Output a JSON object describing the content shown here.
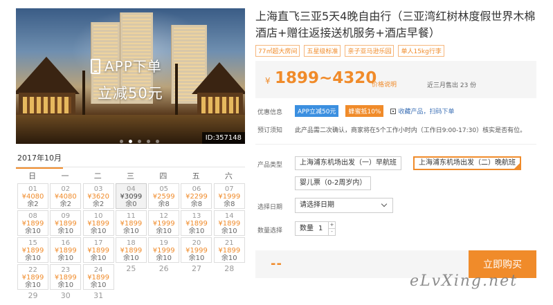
{
  "hero": {
    "banner_line1": "APP下单",
    "banner_line2": "立减50元",
    "product_id": "ID:357148",
    "slide_count": 5,
    "active_slide": 1
  },
  "calendar": {
    "month": "2017年10月",
    "weekdays": [
      "日",
      "一",
      "二",
      "三",
      "四",
      "五",
      "六"
    ],
    "days": [
      {
        "day": "01",
        "price": "¥4080",
        "stock": "余2"
      },
      {
        "day": "02",
        "price": "¥4080",
        "stock": "余2"
      },
      {
        "day": "03",
        "price": "¥3620",
        "stock": "余2"
      },
      {
        "day": "04",
        "price": "¥3099",
        "stock": "余0",
        "selected": true
      },
      {
        "day": "05",
        "price": "¥2599",
        "stock": "余8"
      },
      {
        "day": "06",
        "price": "¥2299",
        "stock": "余8"
      },
      {
        "day": "07",
        "price": "¥1999",
        "stock": "余8"
      },
      {
        "day": "08",
        "price": "¥1899",
        "stock": "余10"
      },
      {
        "day": "09",
        "price": "¥1899",
        "stock": "余10"
      },
      {
        "day": "10",
        "price": "¥1899",
        "stock": "余10"
      },
      {
        "day": "11",
        "price": "¥1899",
        "stock": "余10"
      },
      {
        "day": "12",
        "price": "¥1999",
        "stock": "余10"
      },
      {
        "day": "13",
        "price": "¥1899",
        "stock": "余10"
      },
      {
        "day": "14",
        "price": "¥1899",
        "stock": "余10"
      },
      {
        "day": "15",
        "price": "¥1899",
        "stock": "余10"
      },
      {
        "day": "16",
        "price": "¥1899",
        "stock": "余10"
      },
      {
        "day": "17",
        "price": "¥1899",
        "stock": "余10"
      },
      {
        "day": "18",
        "price": "¥1899",
        "stock": "余10"
      },
      {
        "day": "19",
        "price": "¥1999",
        "stock": "余10"
      },
      {
        "day": "20",
        "price": "¥1999",
        "stock": "余10"
      },
      {
        "day": "21",
        "price": "¥1899",
        "stock": "余10"
      },
      {
        "day": "22",
        "price": "¥1899",
        "stock": "余10"
      },
      {
        "day": "23",
        "price": "¥1899",
        "stock": "余10"
      },
      {
        "day": "24",
        "price": "¥1899",
        "stock": "余10"
      },
      {
        "day": "25"
      },
      {
        "day": "26"
      },
      {
        "day": "27"
      },
      {
        "day": "28"
      },
      {
        "day": "29"
      },
      {
        "day": "30"
      },
      {
        "day": "31"
      }
    ]
  },
  "product": {
    "title": "上海直飞三亚5天4晚自由行（三亚湾红树林度假世界木棉酒店+赠往返接送机服务+酒店早餐）",
    "tags": [
      "77㎡超大房间",
      "五星级标准",
      "亲子亚马逊乐园",
      "单人15kg行李"
    ],
    "price_currency": "¥",
    "price_range": "1899~4320",
    "price_note": "价格说明",
    "sold_text": "近三月售出 23 份"
  },
  "promo": {
    "label": "优惠信息",
    "badge_app": "APP立减50元",
    "badge_bee": "蜂蜜抵10%",
    "qr_text": "收藏产品，扫码下单"
  },
  "notice": {
    "label": "预订须知",
    "text": "此产品需二次确认，商家将在5个工作小时内（工作日9:00-17:30）核实是否有位。"
  },
  "product_type": {
    "label": "产品类型",
    "options": [
      {
        "text": "上海浦东机场出发（一）早航班",
        "selected": false
      },
      {
        "text": "上海浦东机场出发（二）晚航班",
        "selected": true
      },
      {
        "text": "婴儿票（0-2周岁内）",
        "selected": false
      }
    ]
  },
  "date_select": {
    "label": "选择日期",
    "placeholder": "请选择日期"
  },
  "quantity": {
    "label": "数量选择",
    "unit_label": "数量",
    "value": "1",
    "plus": "+",
    "minus": "-"
  },
  "buy": {
    "total": "--",
    "button": "立即购买"
  },
  "watermark": "eLvXing.net",
  "colors": {
    "accent": "#f08b2a",
    "app_badge": "#3b8fe0",
    "price_bg": "#f5f5f5"
  }
}
